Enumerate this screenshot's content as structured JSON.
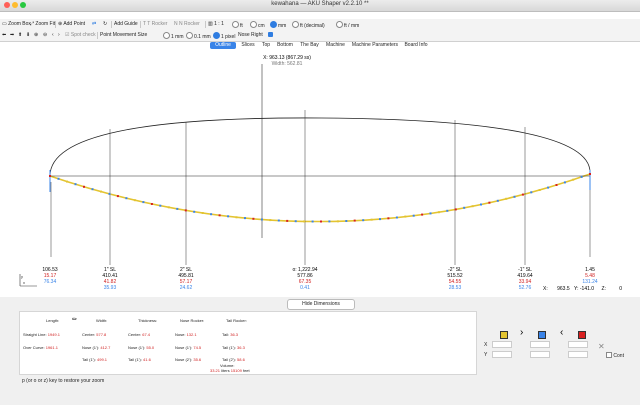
{
  "window": {
    "title": "kewahana — AKU Shaper v2.2.10 **"
  },
  "toolbar1": {
    "zoom_box": "Zoom Box",
    "zoom_fit": "Zoom Fit",
    "add_point": "Add Point",
    "add_guide": "Add Guide",
    "t_rocker": "T Rocker",
    "n_rocker": "N Rocker",
    "scale_11": "1 : 1",
    "ft": "ft",
    "cm": "cm",
    "mm": "mm",
    "ft_dec": "ft (decimal)",
    "ft_mm": "ft / mm"
  },
  "toolbar2": {
    "spot_check": "Spot check",
    "point_movement_label": "Point Movement Size",
    "opt_1mm": "1 mm",
    "opt_01mm": "0.1 mm",
    "opt_1px": "1 pixel",
    "nose_right": "Nose Right"
  },
  "tabs": [
    "Outline",
    "Slices",
    "Top",
    "Bottom",
    "The Bay",
    "Machine",
    "Machine Parameters",
    "Board Info"
  ],
  "active_tab": "Outline",
  "readout": {
    "x_line": "X: 963.13 (867.29 ss)",
    "width_line": "Width: 562.81"
  },
  "stations": [
    {
      "label": "106.53",
      "red": "15.17",
      "blue": "76.34"
    },
    {
      "label": "1\" SL",
      "sub": "410.41",
      "red": "41.82",
      "blue": "35.93"
    },
    {
      "label": "2\" SL",
      "sub": "495.81",
      "red": "57.17",
      "blue": "24.62"
    },
    {
      "label": "o: 1,222.94",
      "sub": "577.86",
      "red": "67.35",
      "blue": "0.41"
    },
    {
      "label": "-2\" SL",
      "sub": "515.52",
      "red": "54.55",
      "blue": "28.53"
    },
    {
      "label": "-1\" SL",
      "sub": "419.64",
      "red": "33.94",
      "blue": "52.76"
    },
    {
      "label": "1.45",
      "red": "5.48",
      "blue": "131.24"
    }
  ],
  "coords": {
    "x_label": "X:",
    "x_val": "963.5",
    "y_val": "Y: -141.0",
    "z_label": "Z:",
    "z_val": "0"
  },
  "hide_dimensions": "Hide Dimensions",
  "dims": {
    "length_h": "Length:",
    "width_h": "Width:",
    "thickness_h": "Thickness:",
    "nose_rocker_h": "Nose Rocker:",
    "tail_rocker_h": "Tail Rocker:",
    "straight_line": "Straight Line:",
    "straight_val": "1949.1",
    "over_curve": "Over Curve:",
    "over_val": "1961.1",
    "w_center": "Center:",
    "w_center_v": "577.8",
    "w_nose": "Nose (1'):",
    "w_nose_v": "412.7",
    "w_tail": "Tail (1'):",
    "w_tail_v": "499.1",
    "t_center": "Center:",
    "t_center_v": "67.4",
    "t_nose": "Nose (1'):",
    "t_nose_v": "55.0",
    "t_tail": "Tail (1'):",
    "t_tail_v": "41.6",
    "nr_nose": "Nose:",
    "nr_nose_v": "132.1",
    "nr_1": "Nose (1'):",
    "nr_1_v": "74.5",
    "nr_2": "Nose (2'):",
    "nr_2_v": "35.6",
    "tr_tail": "Tail:",
    "tr_tail_v": "36.3",
    "tr_1": "Tail (1'):",
    "tr_1_v": "36.3",
    "tr_2": "Tail (2'):",
    "tr_2_v": "58.6",
    "volume_label": "Volume:",
    "vol_liters": "33.21",
    "liters": "liters",
    "vol_feet": "15109",
    "feet": "feet"
  },
  "hint": "p (or o or z) key to restore your zoom",
  "side": {
    "x_label": "X",
    "y_label": "Y",
    "cont": "Cont"
  }
}
